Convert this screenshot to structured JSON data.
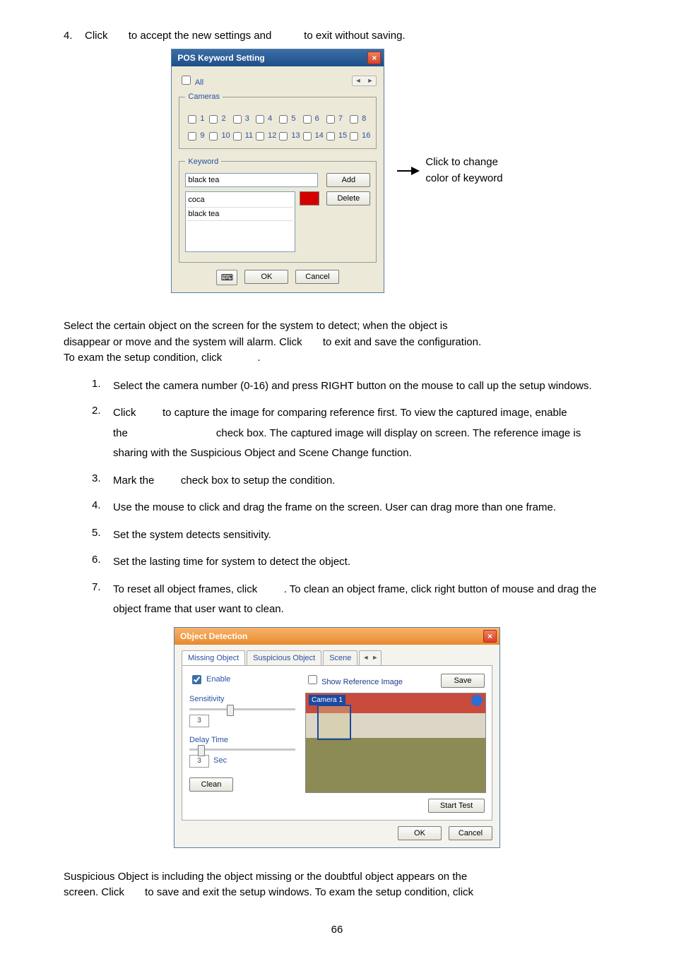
{
  "top_line": {
    "num": "4.",
    "pre": "Click",
    "mid": "to accept the new settings and",
    "post": "to exit without saving."
  },
  "pos_dialog": {
    "title": "POS Keyword Setting",
    "all_label": "All",
    "cameras_legend": "Cameras",
    "cams": [
      "1",
      "2",
      "3",
      "4",
      "5",
      "6",
      "7",
      "8",
      "9",
      "10",
      "11",
      "12",
      "13",
      "14",
      "15",
      "16"
    ],
    "keyword_legend": "Keyword",
    "kw_input_value": "black tea",
    "add_label": "Add",
    "delete_label": "Delete",
    "kw_list": [
      "coca",
      "black tea"
    ],
    "swatch_color": "#d40000",
    "ok_label": "OK",
    "cancel_label": "Cancel"
  },
  "callout": {
    "line1": "Click to change",
    "line2": "color of keyword"
  },
  "section1_para": {
    "l1a": "Select the certain object on the screen for the system to detect; when the object is",
    "l2a": "disappear or move and the system will alarm. Click",
    "l2b": "to exit and save the configuration.",
    "l3a": "To exam the setup condition, click",
    "l3b": "."
  },
  "steps1": [
    {
      "n": "1.",
      "t": "Select the camera number (0-16) and press RIGHT button on the mouse to call up the setup windows."
    },
    {
      "n": "2.",
      "pre": "Click",
      "mid": "to capture the image for comparing reference first. To view the captured image, enable the",
      "post": "check box. The captured image will display on screen. The reference image is sharing with the Suspicious Object and Scene Change function."
    },
    {
      "n": "3.",
      "pre": "Mark the",
      "post": "check box to setup the condition."
    },
    {
      "n": "4.",
      "t": "Use the mouse to click and drag the frame on the screen. User can drag more than one frame."
    },
    {
      "n": "5.",
      "t": "Set the system detects sensitivity."
    },
    {
      "n": "6.",
      "t": "Set the lasting time for system to detect the object."
    },
    {
      "n": "7.",
      "pre": "To reset all object frames, click",
      "post": ". To clean an object frame, click right button of mouse and drag the object frame that user want to clean."
    }
  ],
  "obj_dialog": {
    "title": "Object Detection",
    "tabs": [
      "Missing Object",
      "Suspicious Object",
      "Scene"
    ],
    "show_ref_label": "Show Reference Image",
    "save_label": "Save",
    "enable_label": "Enable",
    "sensitivity_label": "Sensitivity",
    "sensitivity_value": "3",
    "delay_label": "Delay Time",
    "delay_value": "3",
    "sec_label": "Sec",
    "clean_label": "Clean",
    "camera_name": "Camera 1",
    "start_test_label": "Start Test",
    "ok_label": "OK",
    "cancel_label": "Cancel"
  },
  "tail_para": {
    "l1": "Suspicious Object is including the object missing or the doubtful object appears on the",
    "l2a": "screen. Click",
    "l2b": "to save and exit the setup windows. To exam the setup condition, click"
  },
  "page_number": "66"
}
